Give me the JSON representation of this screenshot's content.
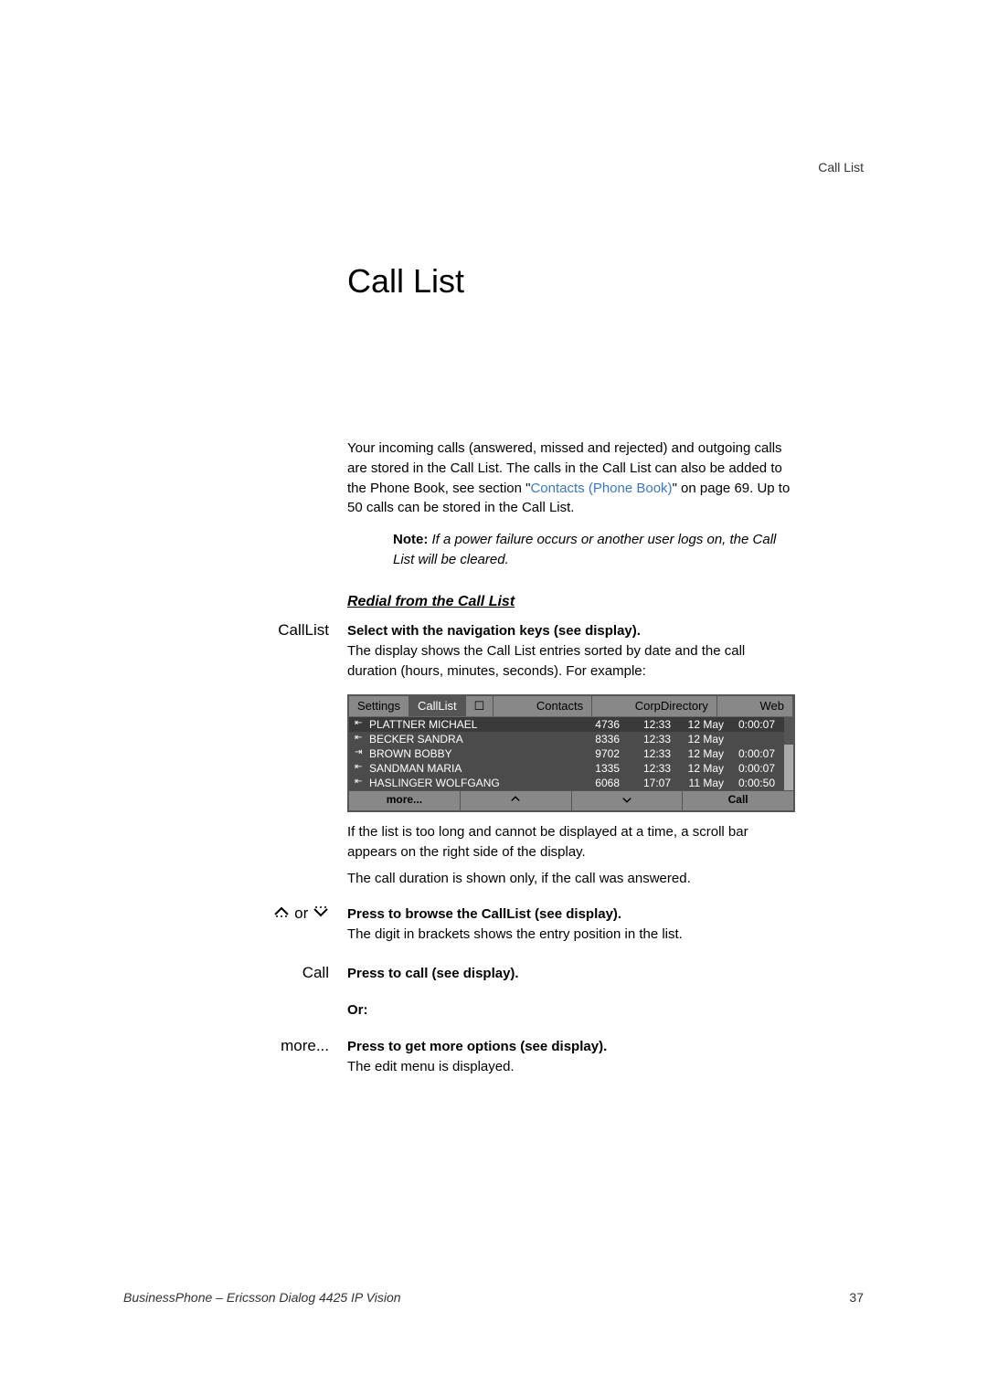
{
  "header": {
    "running_head": "Call List"
  },
  "title": "Call List",
  "intro": {
    "part1": "Your incoming calls (answered, missed and rejected) and outgoing calls are stored in the Call List. The calls in the Call List can also be added to the Phone Book, see section \"",
    "link": "Contacts (Phone Book)",
    "part2": "\" on page 69. Up to 50 calls can be stored in the Call List."
  },
  "note": {
    "label": "Note:",
    "text": "If a power failure occurs or another user logs on, the Call List will be cleared."
  },
  "section": {
    "heading": "Redial from the Call List"
  },
  "instructions": {
    "callList": {
      "label": "CallList",
      "bold": "Select with the navigation keys (see display).",
      "text": "The display shows the Call List entries sorted by date and the call duration (hours, minutes, seconds). For example:"
    },
    "navKeys": {
      "label_middle": " or ",
      "bold": "Press to browse the CallList (see display).",
      "text": "The digit in brackets shows the entry position in the list."
    },
    "call": {
      "label": "Call",
      "bold": "Press to call (see display)."
    },
    "or": {
      "bold": "Or:"
    },
    "more": {
      "label": "more...",
      "bold": "Press to get more options (see display).",
      "text": "The edit menu is displayed."
    }
  },
  "postDisplay": {
    "text1": "If the list is too long and cannot be displayed at a time, a scroll bar appears on the right side of the display.",
    "text2": "The call duration is shown only, if the call was answered."
  },
  "phoneDisplay": {
    "tabs": [
      "Settings",
      "CallList",
      "☐",
      "Contacts",
      "CorpDirectory",
      "Web"
    ],
    "activeTab": 1,
    "rows": [
      {
        "dir": "in",
        "name": "PLATTNER MICHAEL",
        "ext": "4736",
        "time": "12:33",
        "date": "12 May",
        "dur": "0:00:07"
      },
      {
        "dir": "in",
        "name": "BECKER SANDRA",
        "ext": "8336",
        "time": "12:33",
        "date": "12 May",
        "dur": ""
      },
      {
        "dir": "out",
        "name": "BROWN BOBBY",
        "ext": "9702",
        "time": "12:33",
        "date": "12 May",
        "dur": "0:00:07"
      },
      {
        "dir": "in",
        "name": "SANDMAN MARIA",
        "ext": "1335",
        "time": "12:33",
        "date": "12 May",
        "dur": "0:00:07"
      },
      {
        "dir": "in",
        "name": "HASLINGER WOLFGANG",
        "ext": "6068",
        "time": "17:07",
        "date": "11 May",
        "dur": "0:00:50"
      }
    ],
    "bottom": {
      "more": "more...",
      "call": "Call"
    }
  },
  "footer": {
    "product": "BusinessPhone – Ericsson Dialog 4425 IP Vision",
    "page": "37"
  }
}
